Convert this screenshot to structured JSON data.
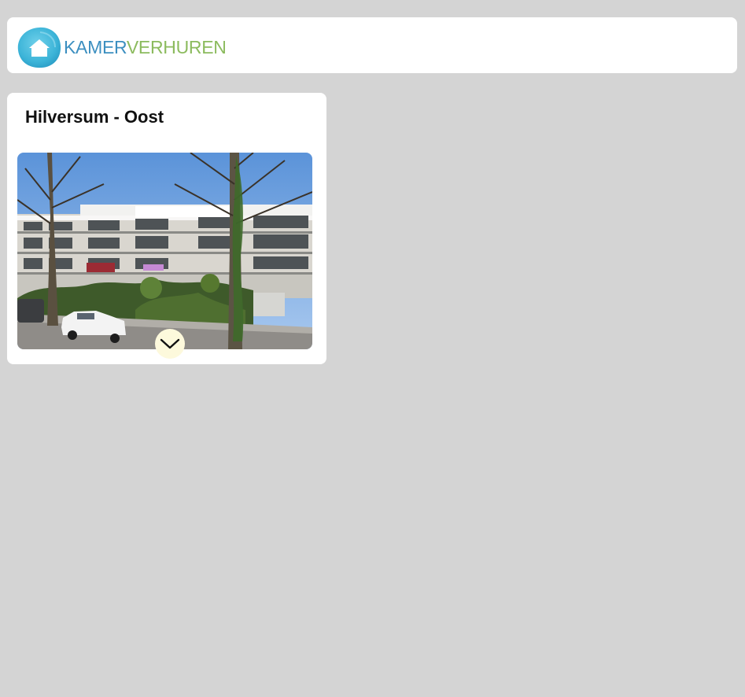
{
  "header": {
    "logo": {
      "part_1": "KAMER",
      "part_2": "VERHUREN",
      "icon": "house-icon",
      "colors": {
        "primary": "#3c8fc0",
        "secondary": "#8cbb5e",
        "mark": "#3cb4d8"
      }
    }
  },
  "listing": {
    "title": "Hilversum - Oost",
    "expand_icon": "chevron-down-icon",
    "expand_button_color": "#fdf9dc"
  }
}
